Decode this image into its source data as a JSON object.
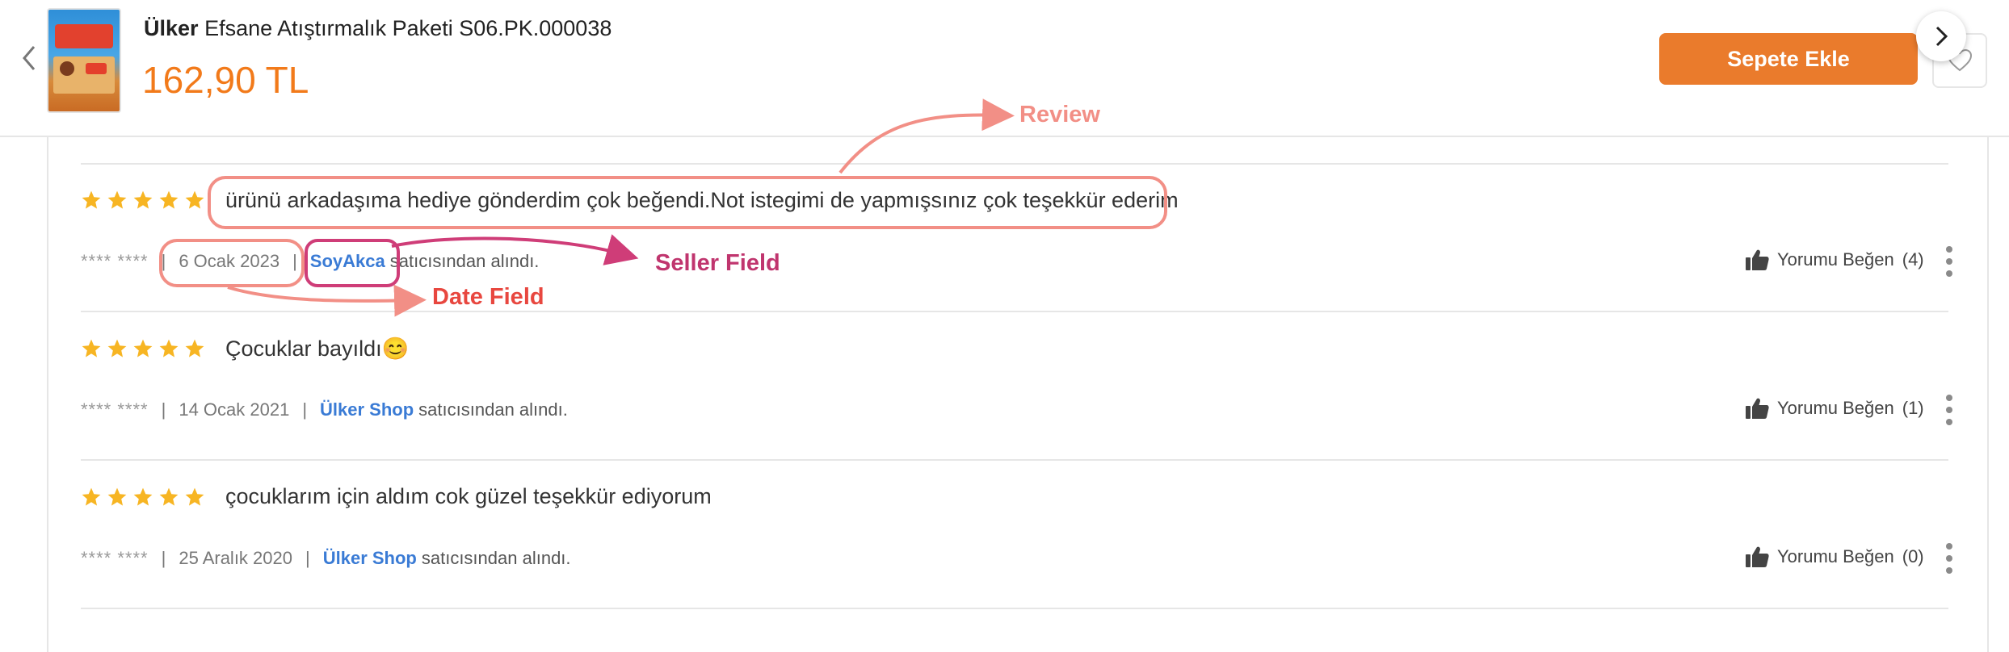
{
  "header": {
    "brand": "Ülker",
    "title": "Efsane Atıştırmalık Paketi S06.PK.000038",
    "price": "162,90 TL",
    "cart_button": "Sepete Ekle"
  },
  "reviews": [
    {
      "rating": 5,
      "text": "ürünü arkadaşıma hediye gönderdim çok beğendi.Not istegimi de yapmışsınız çok teşekkür ederim",
      "user": "**** ****",
      "date": "6 Ocak 2023",
      "seller": "SoyAkca",
      "seller_suffix": "satıcısından alındı.",
      "like_label": "Yorumu Beğen",
      "like_count": "(4)"
    },
    {
      "rating": 5,
      "text": "Çocuklar bayıldı😊",
      "user": "**** ****",
      "date": "14 Ocak 2021",
      "seller": "Ülker Shop",
      "seller_suffix": "satıcısından alındı.",
      "like_label": "Yorumu Beğen",
      "like_count": "(1)"
    },
    {
      "rating": 5,
      "text": "çocuklarım için aldım cok güzel teşekkür ediyorum",
      "user": "**** ****",
      "date": "25 Aralık 2020",
      "seller": "Ülker Shop",
      "seller_suffix": "satıcısından alındı.",
      "like_label": "Yorumu Beğen",
      "like_count": "(0)"
    }
  ],
  "annotations": {
    "review": "Review",
    "seller": "Seller Field",
    "date": "Date Field"
  },
  "colors": {
    "accent": "#f27a1a",
    "cart_button": "#ea7b2c",
    "star": "#f7b523",
    "seller_link": "#3a7bd5",
    "annotation_salmon": "#f28f86",
    "annotation_pink": "#cf3d78",
    "annotation_red": "#e8473f"
  },
  "icons": [
    "chevron-left-icon",
    "chevron-right-icon",
    "heart-icon",
    "star-icon",
    "thumbs-up-icon",
    "more-vertical-icon"
  ]
}
